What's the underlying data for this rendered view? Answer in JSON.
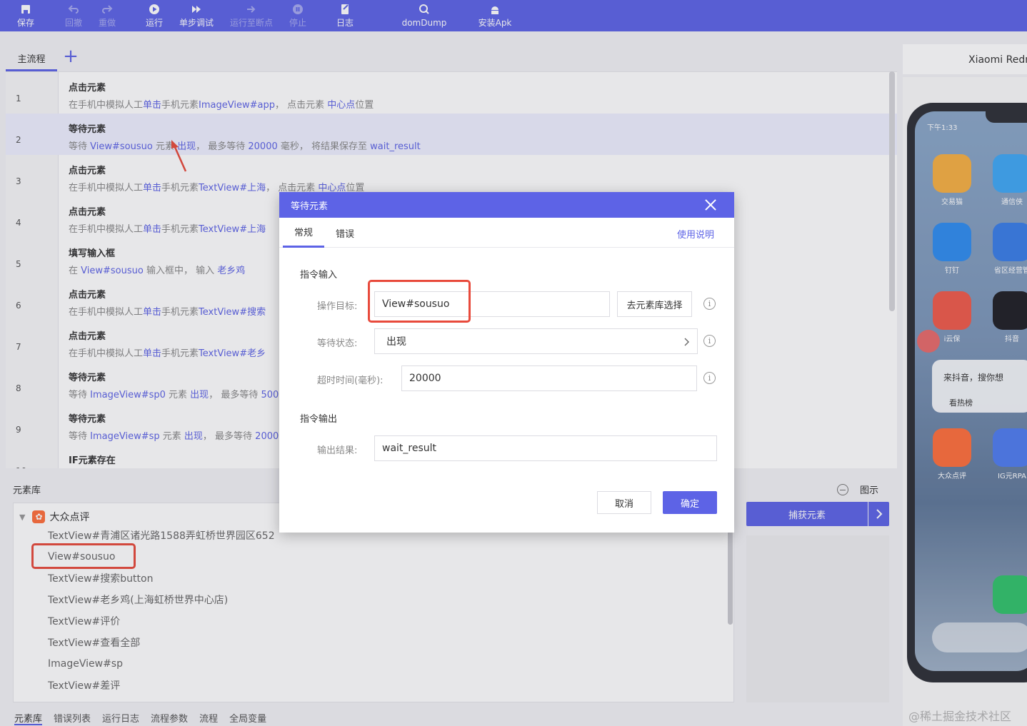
{
  "toolbar": {
    "items": [
      {
        "label": "保存",
        "icon": "save-icon",
        "enabled": true
      },
      {
        "label": "回撤",
        "icon": "undo-icon",
        "enabled": false
      },
      {
        "label": "重做",
        "icon": "redo-icon",
        "enabled": false
      },
      {
        "label": "运行",
        "icon": "play-icon",
        "enabled": true
      },
      {
        "label": "单步调试",
        "icon": "step-debug-icon",
        "enabled": true
      },
      {
        "label": "运行至断点",
        "icon": "run-to-breakpoint-icon",
        "enabled": false
      },
      {
        "label": "停止",
        "icon": "stop-icon",
        "enabled": false
      },
      {
        "label": "日志",
        "icon": "log-icon",
        "enabled": true
      },
      {
        "label": "domDump",
        "icon": "dom-dump-icon",
        "enabled": true
      },
      {
        "label": "安装Apk",
        "icon": "android-icon",
        "enabled": true
      }
    ],
    "color": "#5d63e6"
  },
  "flow_tabs": {
    "main": "主流程",
    "add": "+"
  },
  "flow": {
    "rows": [
      {
        "num": "1",
        "title": "点击元素",
        "desc": [
          [
            "在手机中模拟人工",
            false
          ],
          [
            "单击",
            true
          ],
          [
            "手机元素",
            false
          ],
          [
            "ImageView#app",
            true
          ],
          [
            "， 点击元素 ",
            false
          ],
          [
            "中心点",
            true
          ],
          [
            "位置",
            false
          ]
        ]
      },
      {
        "num": "2",
        "title": "等待元素",
        "desc": [
          [
            "等待 ",
            false
          ],
          [
            "View#sousuo",
            true
          ],
          [
            " 元素 ",
            false
          ],
          [
            "出现",
            true
          ],
          [
            "， 最多等待 ",
            false
          ],
          [
            "20000",
            true
          ],
          [
            " 毫秒， 将结果保存至 ",
            false
          ],
          [
            "wait_result",
            true
          ]
        ]
      },
      {
        "num": "3",
        "title": "点击元素",
        "desc": [
          [
            "在手机中模拟人工",
            false
          ],
          [
            "单击",
            true
          ],
          [
            "手机元素",
            false
          ],
          [
            "TextView#上海",
            true
          ],
          [
            "， 点击元素 ",
            false
          ],
          [
            "中心点",
            true
          ],
          [
            "位置",
            false
          ]
        ]
      },
      {
        "num": "4",
        "title": "点击元素",
        "desc": [
          [
            "在手机中模拟人工",
            false
          ],
          [
            "单击",
            true
          ],
          [
            "手机元素",
            false
          ],
          [
            "TextView#上海",
            true
          ]
        ]
      },
      {
        "num": "5",
        "title": "填写输入框",
        "desc": [
          [
            "在 ",
            false
          ],
          [
            "View#sousuo",
            true
          ],
          [
            " 输入框中， 输入 ",
            false
          ],
          [
            "老乡鸡",
            true
          ]
        ]
      },
      {
        "num": "6",
        "title": "点击元素",
        "desc": [
          [
            "在手机中模拟人工",
            false
          ],
          [
            "单击",
            true
          ],
          [
            "手机元素",
            false
          ],
          [
            "TextView#搜索",
            true
          ]
        ]
      },
      {
        "num": "7",
        "title": "点击元素",
        "desc": [
          [
            "在手机中模拟人工",
            false
          ],
          [
            "单击",
            true
          ],
          [
            "手机元素",
            false
          ],
          [
            "TextView#老乡",
            true
          ]
        ]
      },
      {
        "num": "8",
        "title": "等待元素",
        "desc": [
          [
            "等待 ",
            false
          ],
          [
            "ImageView#sp0",
            true
          ],
          [
            " 元素 ",
            false
          ],
          [
            "出现",
            true
          ],
          [
            "， 最多等待 ",
            false
          ],
          [
            "500",
            true
          ]
        ]
      },
      {
        "num": "9",
        "title": "等待元素",
        "desc": [
          [
            "等待 ",
            false
          ],
          [
            "ImageView#sp",
            true
          ],
          [
            " 元素 ",
            false
          ],
          [
            "出现",
            true
          ],
          [
            "， 最多等待 ",
            false
          ],
          [
            "2000",
            true
          ]
        ]
      },
      {
        "num": "10",
        "title": "IF元素存在",
        "desc": []
      }
    ]
  },
  "library": {
    "title": "元素库",
    "group": "大众点评",
    "items": [
      "TextView#青浦区诸光路1588弄虹桥世界园区652",
      "View#sousuo",
      "TextView#搜索button",
      "TextView#老乡鸡(上海虹桥世界中心店)",
      "TextView#评价",
      "TextView#查看全部",
      "ImageView#sp",
      "TextView#差评"
    ]
  },
  "bottom_tabs": [
    "元素库",
    "错误列表",
    "运行日志",
    "流程参数",
    "流程",
    "全局变量"
  ],
  "device": {
    "name": "Xiaomi Redmi",
    "status_time": "下午1:33",
    "apps": [
      "交易猫",
      "通信侠",
      "钉钉",
      "省区经营管",
      "i云保",
      "抖音",
      "大众点评",
      "IG元RPA"
    ],
    "widget_text": "来抖音，搜你想",
    "widget_sub": "看热榜"
  },
  "preview": {
    "label": "图示",
    "capture": "捕获元素"
  },
  "dialog": {
    "title": "等待元素",
    "tabs": [
      "常规",
      "错误"
    ],
    "help": "使用说明",
    "input_section": "指令输入",
    "target_label": "操作目标:",
    "target_value": "View#sousuo",
    "lib_button": "去元素库选择",
    "state_label": "等待状态:",
    "state_value": "出现",
    "timeout_label": "超时时间(毫秒):",
    "timeout_value": "20000",
    "output_section": "指令输出",
    "result_label": "输出结果:",
    "result_value": "wait_result",
    "cancel": "取消",
    "ok": "确定"
  },
  "watermark": "@稀土掘金技术社区"
}
